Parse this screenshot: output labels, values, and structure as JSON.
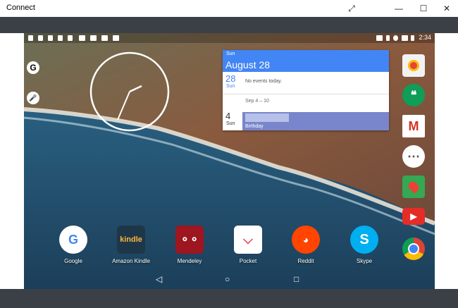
{
  "window": {
    "title": "Connect",
    "controls": {
      "expand": "⤢",
      "minimize": "—",
      "maximize": "☐",
      "close": "✕"
    }
  },
  "status_bar": {
    "time": "2:34"
  },
  "left_shortcuts": [
    {
      "name": "google-search",
      "glyph": "G",
      "color": "#4285f4"
    },
    {
      "name": "voice-search",
      "glyph": "🎤",
      "color": "#4285f4"
    }
  ],
  "calendar_widget": {
    "header_day": "Sun",
    "header_date": "August 28",
    "rows": [
      {
        "day": "28",
        "dow": "Sun",
        "event": "No events today."
      },
      {
        "range": "Sep 4 – 10"
      },
      {
        "day": "4",
        "dow": "Sun",
        "event": "Birthday"
      }
    ]
  },
  "apps": [
    {
      "label": "Google",
      "color": "#ffffff"
    },
    {
      "label": "Amazon Kindle",
      "color": "#1e3748"
    },
    {
      "label": "Mendeley",
      "color": "#9d1620"
    },
    {
      "label": "Pocket",
      "color": "#ffffff"
    },
    {
      "label": "Reddit",
      "color": "#ff4500"
    },
    {
      "label": "Skype",
      "color": "#00aff0"
    }
  ],
  "dock": [
    {
      "name": "camera",
      "color": "#f2f2f2",
      "glyph": ""
    },
    {
      "name": "hangouts",
      "color": "#0f9d58",
      "glyph": "❝"
    },
    {
      "name": "gmail",
      "color": "#ffffff",
      "glyph": "M"
    },
    {
      "name": "app-drawer",
      "color": "#ffffff",
      "glyph": "⋯"
    },
    {
      "name": "maps",
      "color": "#34a853",
      "glyph": ""
    },
    {
      "name": "youtube",
      "color": "#e52d27",
      "glyph": "▶"
    },
    {
      "name": "chrome",
      "color": "#db4437",
      "glyph": ""
    }
  ],
  "nav": {
    "back": "◁",
    "home": "○",
    "recents": "□"
  }
}
